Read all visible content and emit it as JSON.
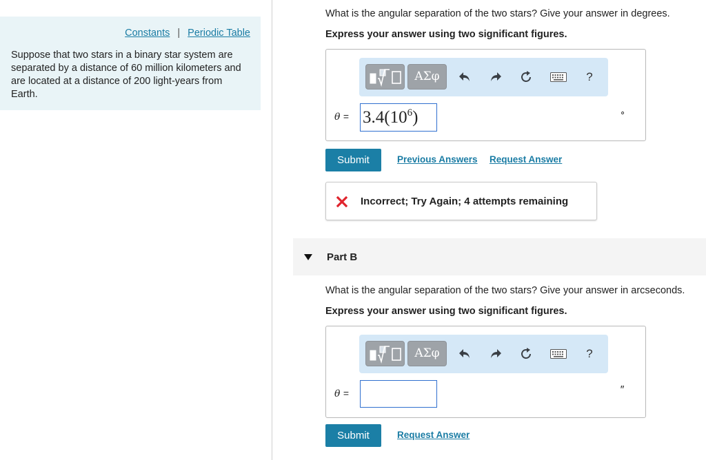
{
  "sidebar": {
    "links": [
      "Constants",
      "Periodic Table"
    ],
    "separator": "|",
    "problem_text": "Suppose that two stars in a binary star system are separated by a distance of 60 million kilometers and are located at a distance of 200 light-years from Earth."
  },
  "toolbar": {
    "templates_icon": "templates-icon",
    "symbols_label": "ΑΣφ",
    "undo_icon": "undo-icon",
    "redo_icon": "redo-icon",
    "reset_icon": "reset-icon",
    "keyboard_icon": "keyboard-icon",
    "help_label": "?"
  },
  "partA": {
    "question": "What is the angular separation of the two stars? Give your answer in degrees.",
    "instruction": "Express your answer using two significant figures.",
    "variable": "θ",
    "equals": "=",
    "answer_mantissa": "3.4(10",
    "answer_exponent": "6",
    "answer_close": ")",
    "unit": "∘",
    "submit_label": "Submit",
    "previous_answers_label": "Previous Answers",
    "request_answer_label": "Request Answer",
    "feedback": "Incorrect; Try Again; 4 attempts remaining"
  },
  "partB": {
    "title": "Part B",
    "question": "What is the angular separation of the two stars? Give your answer in arcseconds.",
    "instruction": "Express your answer using two significant figures.",
    "variable": "θ",
    "equals": "=",
    "answer_value": "",
    "unit": "″",
    "submit_label": "Submit",
    "request_answer_label": "Request Answer"
  },
  "colors": {
    "accent": "#1b7fa6",
    "link": "#1a7ca4",
    "panel_bg": "#e9f4f7",
    "toolbar_bg": "#d5e8f7",
    "error": "#e0242d"
  }
}
